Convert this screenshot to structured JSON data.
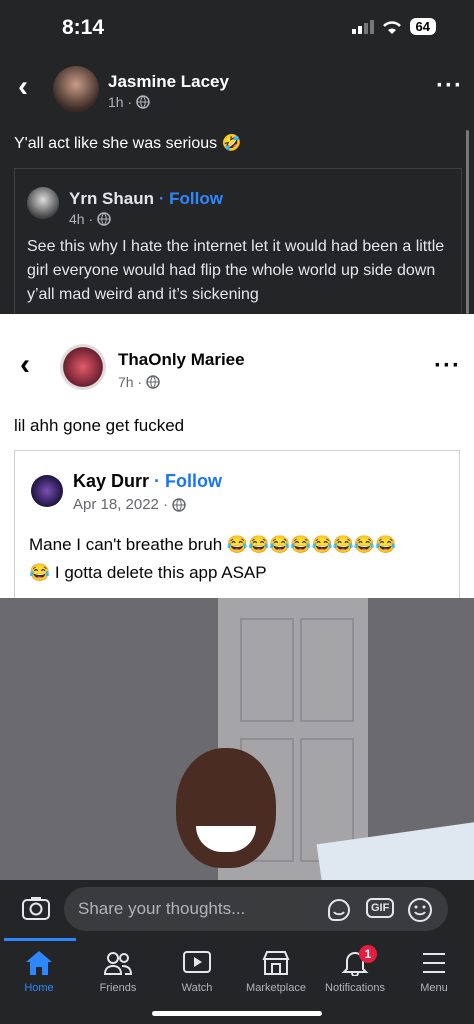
{
  "status": {
    "time": "8:14",
    "battery": "64"
  },
  "post1": {
    "author": "Jasmine Lacey",
    "time": "1h ·",
    "text": "Y'all act like she was serious 🤣",
    "shared": {
      "author": "Yrn Shaun",
      "follow": "· Follow",
      "time": "4h ·",
      "text": "See this why I hate the internet let it would had been a little girl everyone would had flip the whole world up side down y’all mad weird and it’s sickening"
    }
  },
  "post2": {
    "author": "ThaOnly Mariee",
    "time": "7h ·",
    "text": "lil ahh gone get fucked",
    "shared": {
      "author": "Kay Durr",
      "follow": "· Follow",
      "time": "Apr 18, 2022 ·",
      "text_line1": "Mane I can't breathe bruh 😂😂😂😂😂😂😂😂",
      "text_line2": "😂 I gotta delete this app ASAP"
    }
  },
  "composer": {
    "placeholder": "Share your thoughts..."
  },
  "tabs": [
    {
      "label": "Home",
      "active": true
    },
    {
      "label": "Friends"
    },
    {
      "label": "Watch"
    },
    {
      "label": "Marketplace"
    },
    {
      "label": "Notifications",
      "badge": "1"
    },
    {
      "label": "Menu"
    }
  ],
  "colors": {
    "accent": "#2d88ff",
    "dark_bg": "#242526",
    "badge": "#e41e3f"
  }
}
